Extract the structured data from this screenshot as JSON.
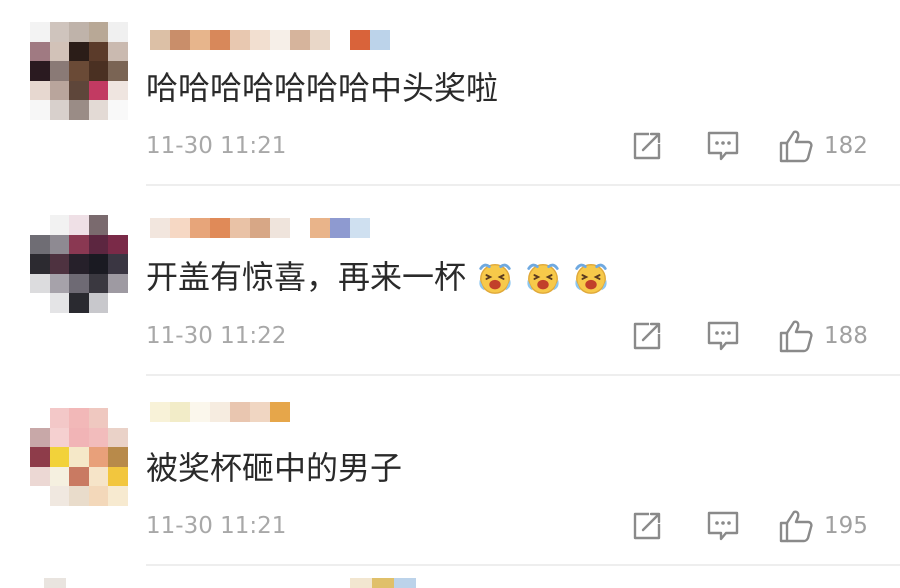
{
  "comments": [
    {
      "avatar_colors": [
        "#f3f3f3",
        "#cfc4bd",
        "#bfb3aa",
        "#b8a896",
        "#f0f0f0",
        "#a07a82",
        "#d2c2b8",
        "#2b1d18",
        "#5b3b2a",
        "#cabab0",
        "#2a1a20",
        "#8a7a76",
        "#6a4a36",
        "#4a3022",
        "#7a6454",
        "#e7d8d0",
        "#b9a59c",
        "#5e463a",
        "#c23a62",
        "#efe5e0",
        "#f7f7f7",
        "#d8d0cc",
        "#9a8c86",
        "#e3dad5",
        "#f9f9f9"
      ],
      "username_colors": [
        "#dcc0a6",
        "#c98e6a",
        "#e7b58c",
        "#d8885a",
        "#e8c8b0",
        "#f2dfd0",
        "#f6efe8",
        "#d6b49c",
        "#e9d7c8",
        "#ffffff",
        "#d9633a",
        "#bcd3ea"
      ],
      "text": "哈哈哈哈哈哈哈中头奖啦",
      "emoji_count": 0,
      "timestamp": "11-30 11:21",
      "likes": "182"
    },
    {
      "avatar_colors": [
        "#ffffff",
        "#f2f2f2",
        "#efe0e6",
        "#7a6a6e",
        "#ffffff",
        "#6f6d74",
        "#8e8a92",
        "#8a3852",
        "#5c2640",
        "#7a2a48",
        "#2c2a30",
        "#4e3240",
        "#26202a",
        "#1a1a22",
        "#3a3642",
        "#dcdcde",
        "#a6a2aa",
        "#6e6a74",
        "#3a3840",
        "#9e9aa2",
        "#ffffff",
        "#e4e4e6",
        "#2a2a30",
        "#c8c8cc",
        "#ffffff"
      ],
      "username_colors": [
        "#f2e6de",
        "#f6d8c4",
        "#e7a57a",
        "#e08a58",
        "#e9c2a6",
        "#d7a786",
        "#efe4dc",
        "#ffffff",
        "#e9b48a",
        "#8e9ad0",
        "#cfe0f0"
      ],
      "text": "开盖有惊喜，再来一杯",
      "emoji_count": 3,
      "timestamp": "11-30 11:22",
      "likes": "188"
    },
    {
      "avatar_colors": [
        "#ffffff",
        "#f3c8c8",
        "#f2b8b8",
        "#efc8c0",
        "#ffffff",
        "#c8a8a8",
        "#f5d0d0",
        "#f1b4b6",
        "#f2bcbc",
        "#ead2c8",
        "#8e3c4a",
        "#f2d23a",
        "#f5e8c8",
        "#e8a07a",
        "#b88a4a",
        "#ecd8d4",
        "#f5f0e0",
        "#c97a62",
        "#f6e4c8",
        "#f2c63e",
        "#ffffff",
        "#f0e8e0",
        "#e9dccb",
        "#f3d8ba",
        "#f7ead0"
      ],
      "username_colors": [
        "#f8f2d8",
        "#f2ecc8",
        "#fbf7ec",
        "#f6ece0",
        "#e9c6b0",
        "#f0d6c2",
        "#e6a64a"
      ],
      "text": "被奖杯砸中的男子",
      "emoji_count": 0,
      "timestamp": "11-30 11:21",
      "likes": "195"
    }
  ],
  "next_peek_colors": [
    "#e9e4df",
    "#f2e6d0",
    "#e0c06a",
    "#bcd3ea"
  ],
  "colors": {
    "text": "#2a2a2a",
    "meta": "#a8a8a8",
    "icon": "#8a8a8a",
    "divider": "#eeeeee"
  },
  "icons": {
    "repost": "share-box-icon",
    "comment": "comment-bubble-icon",
    "like": "thumbs-up-icon"
  }
}
